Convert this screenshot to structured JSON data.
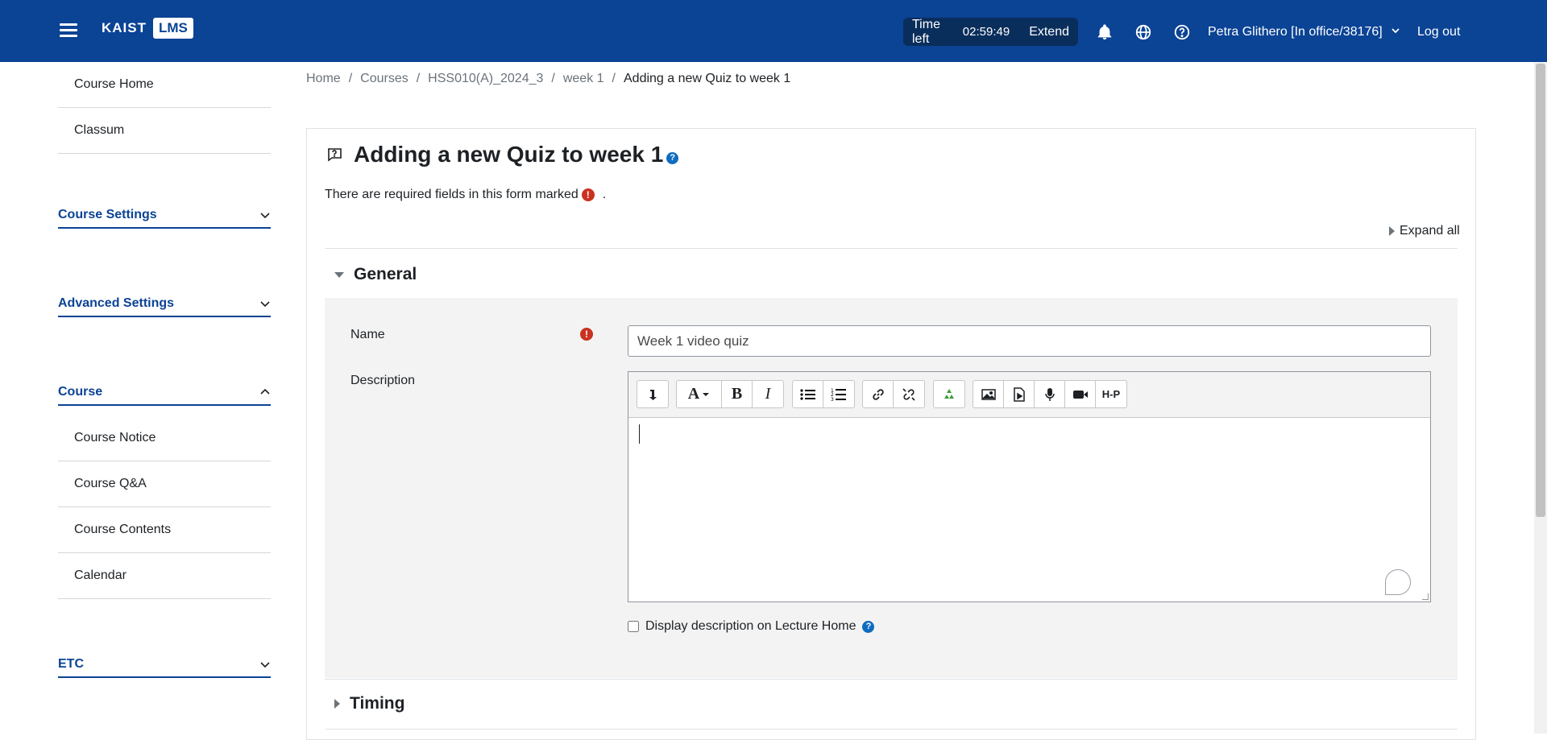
{
  "header": {
    "brand_left": "KAIST",
    "brand_right": "LMS",
    "timer_label": "Time left",
    "timer_value": "02:59:49",
    "extend_label": "Extend",
    "user_name": "Petra Glithero [In office/38176]",
    "logout_label": "Log out",
    "icons": [
      "menu-icon",
      "bell-icon",
      "globe-icon",
      "help-icon",
      "chevron-down-icon"
    ]
  },
  "sidebar": {
    "top_items": [
      {
        "label": "Course Home"
      },
      {
        "label": "Classum"
      }
    ],
    "sections": [
      {
        "label": "Course Settings",
        "expanded": false
      },
      {
        "label": "Advanced Settings",
        "expanded": false
      },
      {
        "label": "Course",
        "expanded": true
      },
      {
        "label": "ETC",
        "expanded": false
      }
    ],
    "course_items": [
      {
        "label": "Course Notice"
      },
      {
        "label": "Course Q&A"
      },
      {
        "label": "Course Contents"
      },
      {
        "label": "Calendar"
      }
    ]
  },
  "breadcrumb": {
    "items": [
      "Home",
      "Courses",
      "HSS010(A)_2024_3",
      "week 1",
      "Adding a new Quiz to week 1"
    ],
    "separator": "/"
  },
  "main": {
    "title": "Adding a new Quiz to week 1",
    "required_note": "There are required fields in this form marked",
    "required_note_end": ".",
    "expand_all": "Expand all",
    "sections": {
      "general": "General",
      "timing": "Timing"
    },
    "form": {
      "name_label": "Name",
      "name_value": "Week 1 video quiz",
      "description_label": "Description",
      "display_desc_label": "Display description on Lecture Home",
      "display_desc_checked": false
    },
    "editor_toolbar": [
      "collapse-icon",
      "font-style-icon",
      "bold-icon",
      "italic-icon",
      "unordered-list-icon",
      "ordered-list-icon",
      "link-icon",
      "unlink-icon",
      "recycle-icon",
      "image-icon",
      "media-icon",
      "microphone-icon",
      "video-icon",
      "h5p-icon"
    ],
    "h5p_label": "H-P"
  },
  "colors": {
    "header_bg": "#0b4395",
    "accent": "#0b4395",
    "required": "#ca3120",
    "help": "#0f6cbf"
  }
}
